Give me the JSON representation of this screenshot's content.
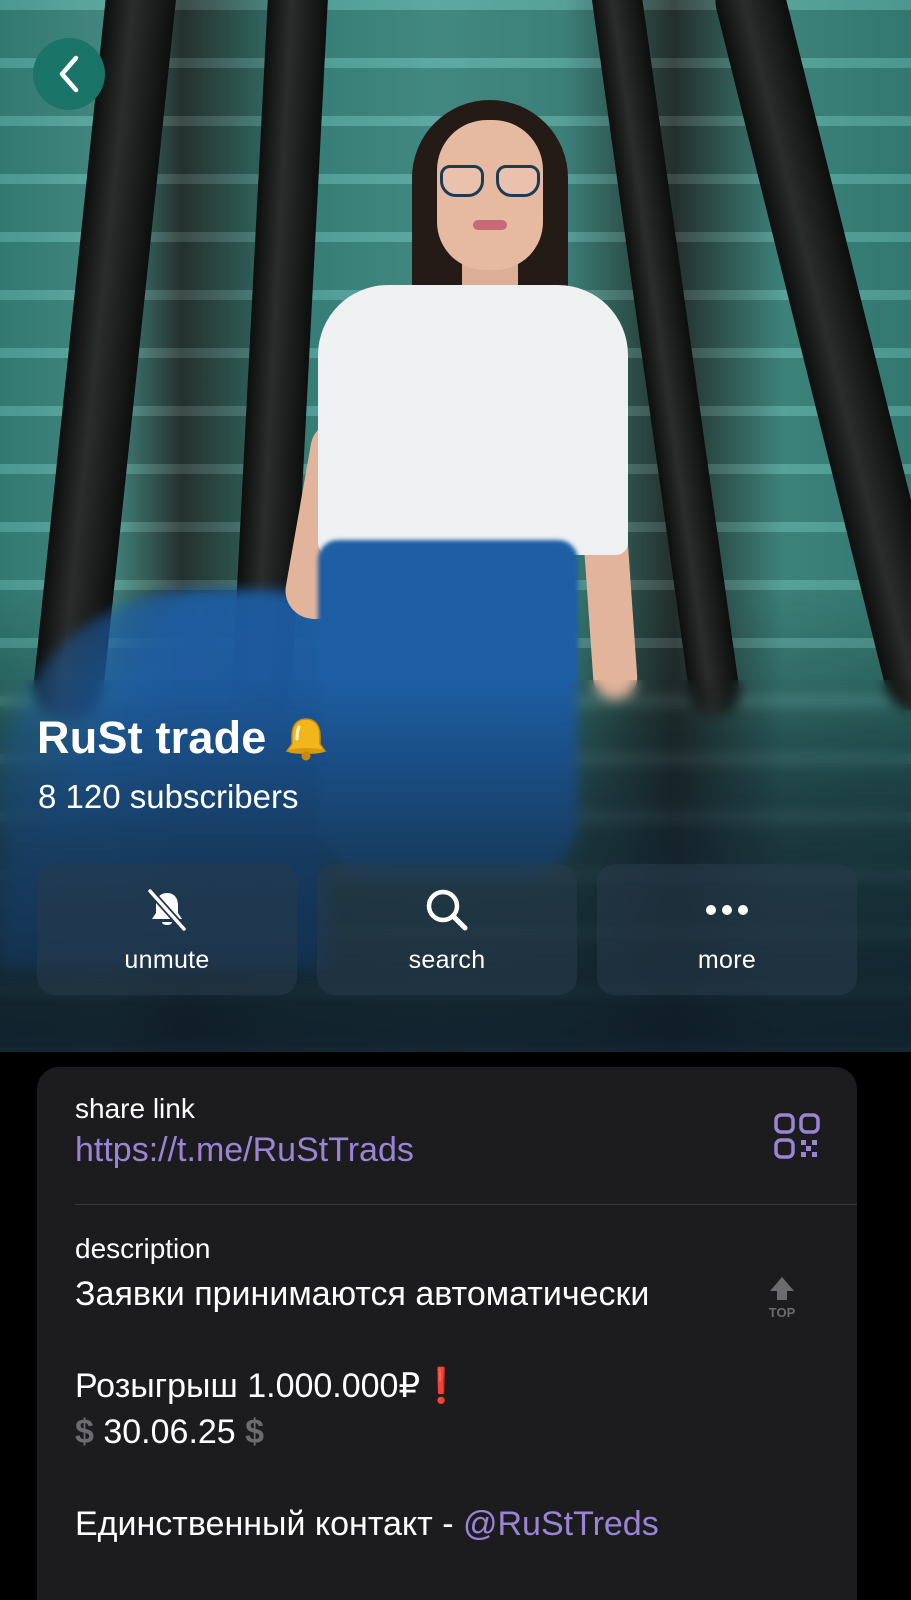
{
  "header": {
    "back_icon": "chevron-left-icon",
    "channel_name": "RuSt trade",
    "title_emoji": "bell-emoji",
    "subscribers": "8 120 subscribers"
  },
  "actions": [
    {
      "label": "unmute",
      "icon": "bell-slash-icon"
    },
    {
      "label": "search",
      "icon": "search-icon"
    },
    {
      "label": "more",
      "icon": "more-dots-icon"
    }
  ],
  "info": {
    "share_link_label": "share link",
    "share_link": "https://t.me/RuStTrads",
    "qr_icon": "qr-code-icon",
    "description_label": "description",
    "description_line1": "Заявки принимаются автоматически",
    "top_icon": "top-arrow-icon",
    "description_line2": "Розыгрыш 1.000.000₽",
    "description_line2_mark": "❗",
    "description_line3_symbol": "$",
    "description_line3": " 30.06.25 ",
    "description_line4": "Единственный контакт - ",
    "contact_mention": "@RuStTreds"
  },
  "colors": {
    "accent_link": "#9a84d6",
    "back_button_bg": "#1b7468",
    "card_bg": "#1c1c1e"
  }
}
